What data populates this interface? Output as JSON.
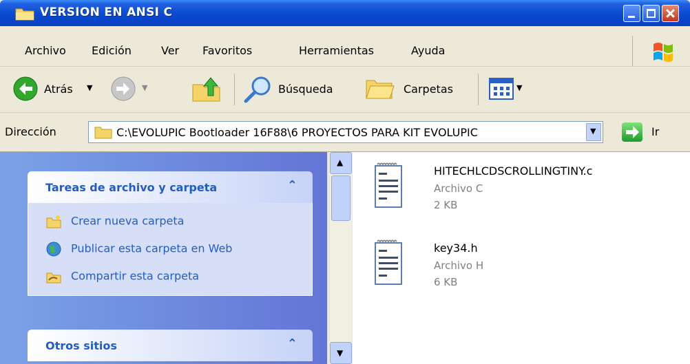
{
  "window": {
    "title": "VERSION EN ANSI C"
  },
  "menu": [
    "Archivo",
    "Edición",
    "Ver",
    "Favoritos",
    "Herramientas",
    "Ayuda"
  ],
  "toolbar": {
    "back_label": "Atrás",
    "search_label": "Búsqueda",
    "folders_label": "Carpetas"
  },
  "address": {
    "label": "Dirección",
    "path": "C:\\EVOLUPIC Bootloader 16F88\\6 PROYECTOS PARA KIT EVOLUPIC",
    "go_label": "Ir"
  },
  "tasks_panel": {
    "title": "Tareas de archivo y carpeta",
    "items": [
      "Crear nueva carpeta",
      "Publicar esta carpeta en Web",
      "Compartir esta carpeta"
    ]
  },
  "other_panel": {
    "title": "Otros sitios"
  },
  "files": [
    {
      "name": "HITECHLCDSCROLLINGTINY.c",
      "type": "Archivo C",
      "size": "2 KB"
    },
    {
      "name": "key34.h",
      "type": "Archivo H",
      "size": "6 KB"
    }
  ],
  "colors": {
    "titlebar": "#0a4ad0",
    "task_link": "#215dc6",
    "left_pane": "#6f8fe0"
  }
}
